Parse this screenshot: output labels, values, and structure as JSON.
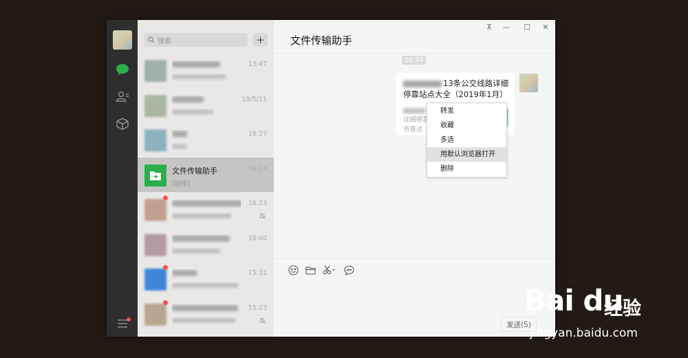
{
  "nav": {
    "icons": [
      "chat-icon",
      "contacts-icon",
      "favorites-icon",
      "menu-icon"
    ]
  },
  "search": {
    "placeholder": "搜索",
    "add_label": "+"
  },
  "sessions": [
    {
      "name": "",
      "preview": "",
      "time": "13:47",
      "muted": false,
      "unread": false,
      "thumb": "#9fb1a8"
    },
    {
      "name": "",
      "preview": "",
      "time": "19/5/11",
      "muted": false,
      "unread": false,
      "thumb": "#aab5a4"
    },
    {
      "name": "",
      "preview": "",
      "time": "16:27",
      "muted": false,
      "unread": false,
      "thumb": "#8db1bf"
    },
    {
      "name": "文件传输助手",
      "preview": "[链接]",
      "time": "16:24",
      "muted": false,
      "unread": false,
      "thumb": "#2bae4b"
    },
    {
      "name": "",
      "preview": "",
      "time": "16:23",
      "muted": true,
      "unread": true,
      "thumb": "#c2a090"
    },
    {
      "name": "",
      "preview": "",
      "time": "16:00",
      "muted": false,
      "unread": false,
      "thumb": "#b49aa5"
    },
    {
      "name": "",
      "preview": "",
      "time": "15:31",
      "muted": false,
      "unread": true,
      "thumb": "#3f86d9"
    },
    {
      "name": "",
      "preview": "",
      "time": "15:23",
      "muted": true,
      "unread": true,
      "thumb": "#b7a690"
    }
  ],
  "chat": {
    "title": "文件传输助手",
    "timestamp": "16:24",
    "card_title": "13条公交线路详细停靠站点大全（2019年1月）",
    "card_desc_lines": [
      "详细停靠",
      "市意达"
    ],
    "window_controls": [
      "⊼",
      "—",
      "☐",
      "✕"
    ]
  },
  "context_menu": {
    "items": [
      "转发",
      "收藏",
      "多选",
      "用默认浏览器打开",
      "删除"
    ],
    "hovered_index": 3
  },
  "composer": {
    "tools": [
      "emoji-icon",
      "folder-icon",
      "scissors-icon",
      "chat-bubble-icon"
    ],
    "send_label": "发送(S)"
  },
  "watermark": {
    "logo": "Bai du",
    "text": "经验",
    "url": "jingyan.baidu.com"
  },
  "colors": {
    "accent": "#2bae4b",
    "badge": "#fa5151",
    "nav_bg": "#2e2e2e"
  }
}
